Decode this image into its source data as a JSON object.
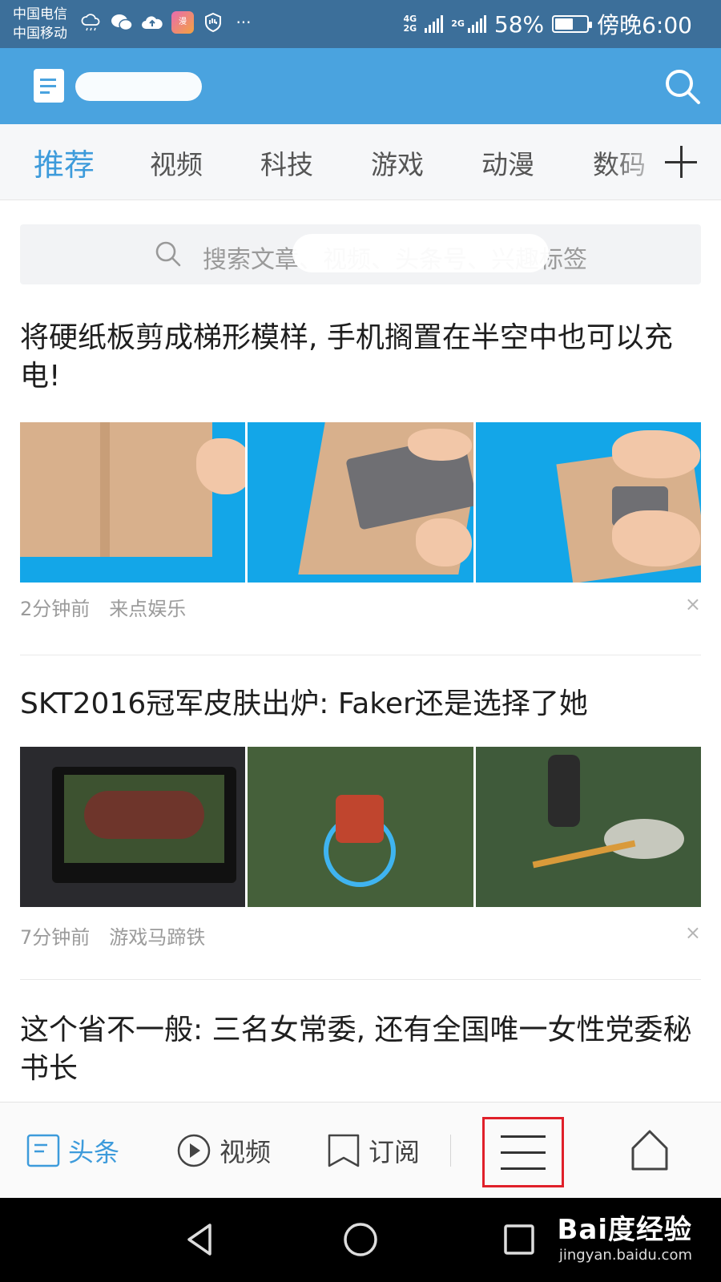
{
  "status_bar": {
    "carrier_1": "中国电信",
    "carrier_2": "中国移动",
    "network_1": "4G",
    "network_2": "2G",
    "network_3": "2G",
    "battery_text": "58%",
    "battery_level": 0.58,
    "time": "傍晚6:00",
    "app_badge": "漫",
    "more": "···"
  },
  "header": {
    "icons": [
      "logo-icon",
      "search-icon"
    ]
  },
  "tabs": {
    "items": [
      "推荐",
      "视频",
      "科技",
      "游戏",
      "动漫",
      "数码"
    ],
    "active_index": 0,
    "active_color": "#3d9bdb"
  },
  "search": {
    "placeholder": "搜索文章、视频、头条号、兴趣标签",
    "visible_prefix": "搜索文",
    "visible_suffix": "标签"
  },
  "feed": [
    {
      "title": "将硬纸板剪成梯形模样, 手机搁置在半空中也可以充电!",
      "time": "2分钟前",
      "source": "来点娱乐",
      "close": "×"
    },
    {
      "title": "SKT2016冠军皮肤出炉: Faker还是选择了她",
      "time": "7分钟前",
      "source": "游戏马蹄铁",
      "close": "×"
    },
    {
      "title": "这个省不一般: 三名女常委, 还有全国唯一女性党委秘书长"
    }
  ],
  "bottom_nav": {
    "headlines": "头条",
    "video": "视频",
    "subscribe": "订阅",
    "icons": [
      "headlines-icon",
      "play-icon",
      "bookmark-icon",
      "menu-icon",
      "home-icon"
    ]
  },
  "watermark": {
    "logo": "Bai度经验",
    "url": "jingyan.baidu.com"
  },
  "colors": {
    "status_bar": "#3c6f9a",
    "app_bar": "#4aa3df",
    "accent": "#3d9bdb",
    "highlight_box": "#e0202a"
  }
}
